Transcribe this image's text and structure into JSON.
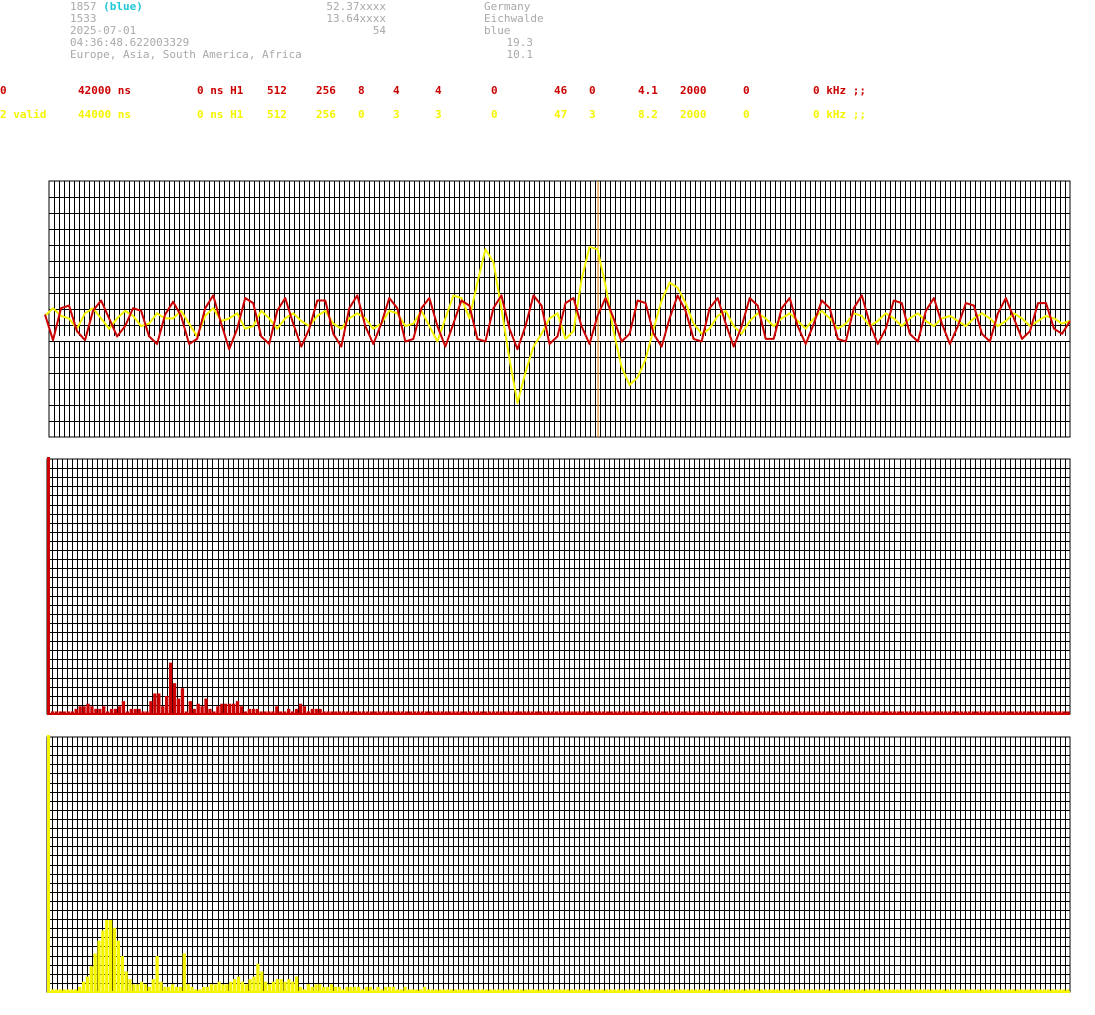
{
  "station": {
    "id": "1857",
    "id_tag": "(blue)",
    "number": "1533",
    "date": "2025-07-01",
    "time": "04:36:48.622003329",
    "regions": "Europe, Asia, South America, Africa",
    "lat": "52.37xxxx",
    "lon": "13.64xxxx",
    "alt": "54",
    "country": "Germany",
    "city": "Eichwalde",
    "color_name": "blue",
    "value1": "19.3",
    "value2": "10.1"
  },
  "channels": [
    {
      "c0": "0",
      "c1": "42000 ns",
      "c2": "0 ns H1",
      "c3": "512",
      "c4": "256",
      "c5": "8",
      "c6": "4",
      "c7": "4",
      "c8": "0",
      "c9": "46",
      "c10": "0",
      "c11": "4.1",
      "c12": "2000",
      "c13": "0",
      "c14": "0 kHz ;;",
      "color": "#cc0000"
    },
    {
      "c0": "2 valid",
      "c1": "44000 ns",
      "c2": "0 ns H1",
      "c3": "512",
      "c4": "256",
      "c5": "0",
      "c6": "3",
      "c7": "3",
      "c8": "0",
      "c9": "47",
      "c10": "3",
      "c11": "8.2",
      "c12": "2000",
      "c13": "0",
      "c14": "0 kHz ;;",
      "color": "#f5f500"
    }
  ],
  "colors": {
    "red": "#cc0000",
    "yellow": "#f5f500",
    "cursor": "#e08000",
    "grid": "#000000"
  },
  "chart_data": [
    {
      "type": "line",
      "title": "",
      "x": [
        0,
        1,
        2,
        3,
        4,
        5,
        6,
        7,
        8,
        9,
        10,
        11,
        12,
        13,
        14,
        15,
        16,
        17,
        18,
        19,
        20,
        21,
        22,
        23,
        24,
        25,
        26,
        27,
        28,
        29,
        30,
        31,
        32,
        33,
        34,
        35,
        36,
        37,
        38,
        39,
        40,
        41,
        42,
        43,
        44,
        45,
        46,
        47,
        48,
        49,
        50,
        51,
        52,
        53,
        54,
        55,
        56,
        57,
        58,
        59,
        60,
        61,
        62,
        63,
        64,
        65,
        66,
        67,
        68,
        69,
        70,
        71,
        72,
        73,
        74,
        75,
        76,
        77,
        78,
        79,
        80,
        81,
        82,
        83,
        84,
        85,
        86,
        87,
        88,
        89,
        90,
        91,
        92,
        93,
        94,
        95,
        96,
        97,
        98,
        99,
        100,
        101,
        102,
        103,
        104,
        105,
        106,
        107,
        108,
        109,
        110,
        111,
        112,
        113,
        114,
        115,
        116,
        117,
        118,
        119,
        120,
        121,
        122,
        123,
        124,
        125,
        126,
        127,
        128
      ],
      "ylim": [
        -1,
        1
      ],
      "grid": true,
      "cursor_x": 69,
      "series": [
        {
          "color": "#cc0000",
          "values": [
            0.05,
            -0.15,
            0.1,
            0.12,
            -0.08,
            -0.15,
            0.08,
            0.16,
            0.02,
            -0.12,
            -0.04,
            0.1,
            0.08,
            -0.12,
            -0.18,
            0.05,
            0.15,
            0.04,
            -0.18,
            -0.14,
            0.1,
            0.2,
            -0.02,
            -0.22,
            -0.06,
            0.18,
            0.14,
            -0.12,
            -0.18,
            0.08,
            0.18,
            -0.02,
            -0.2,
            -0.06,
            0.16,
            0.16,
            -0.1,
            -0.2,
            0.1,
            0.2,
            -0.04,
            -0.18,
            -0.02,
            0.18,
            0.1,
            -0.16,
            -0.14,
            0.1,
            0.18,
            -0.04,
            -0.2,
            -0.02,
            0.16,
            0.12,
            -0.14,
            -0.16,
            0.1,
            0.2,
            -0.06,
            -0.22,
            -0.04,
            0.2,
            0.12,
            -0.18,
            -0.12,
            0.14,
            0.18,
            -0.04,
            -0.18,
            0.04,
            0.18,
            0.02,
            -0.16,
            -0.1,
            0.16,
            0.14,
            -0.1,
            -0.2,
            0.02,
            0.2,
            0.08,
            -0.14,
            -0.16,
            0.1,
            0.18,
            -0.02,
            -0.2,
            -0.04,
            0.18,
            0.12,
            -0.14,
            -0.14,
            0.1,
            0.18,
            -0.04,
            -0.18,
            -0.02,
            0.16,
            0.1,
            -0.14,
            -0.16,
            0.1,
            0.2,
            -0.02,
            -0.18,
            -0.06,
            0.16,
            0.14,
            -0.1,
            -0.16,
            0.08,
            0.18,
            -0.02,
            -0.18,
            -0.04,
            0.14,
            0.12,
            -0.1,
            -0.16,
            0.06,
            0.18,
            0.02,
            -0.14,
            -0.08,
            0.14,
            0.14,
            -0.06,
            -0.1,
            0.0
          ]
        },
        {
          "color": "#f5f500",
          "values": [
            0.04,
            0.1,
            0.04,
            0.02,
            -0.06,
            0.06,
            0.1,
            0.02,
            -0.06,
            0.02,
            0.08,
            0.04,
            -0.04,
            -0.02,
            0.06,
            0.02,
            0.02,
            0.08,
            -0.02,
            -0.12,
            0.04,
            0.1,
            0.0,
            0.02,
            0.06,
            -0.06,
            -0.04,
            0.08,
            0.02,
            -0.06,
            0.02,
            0.06,
            0.0,
            -0.04,
            0.04,
            0.08,
            -0.02,
            -0.06,
            0.02,
            0.06,
            0.02,
            -0.06,
            -0.02,
            0.08,
            0.06,
            -0.04,
            -0.02,
            0.08,
            -0.04,
            -0.16,
            0.02,
            0.2,
            0.18,
            0.02,
            0.3,
            0.56,
            0.46,
            0.1,
            -0.3,
            -0.64,
            -0.4,
            -0.2,
            -0.1,
            0.02,
            0.06,
            -0.14,
            -0.08,
            0.32,
            0.58,
            0.56,
            0.28,
            -0.08,
            -0.36,
            -0.5,
            -0.44,
            -0.3,
            -0.06,
            0.16,
            0.3,
            0.26,
            0.14,
            -0.02,
            -0.1,
            -0.06,
            0.04,
            0.08,
            -0.04,
            -0.1,
            0.0,
            0.06,
            0.02,
            -0.04,
            0.02,
            0.06,
            0.0,
            -0.06,
            0.02,
            0.08,
            0.02,
            -0.06,
            -0.02,
            0.06,
            0.04,
            -0.04,
            0.0,
            0.06,
            0.02,
            -0.04,
            0.02,
            0.06,
            0.0,
            -0.04,
            0.02,
            0.04,
            0.0,
            -0.04,
            0.02,
            0.06,
            0.02,
            -0.04,
            0.0,
            0.06,
            0.02,
            -0.04,
            0.0,
            0.04,
            0.02,
            -0.02,
            0.0
          ]
        }
      ]
    },
    {
      "type": "bar",
      "title": "",
      "color": "#cc0000",
      "ylim": [
        0,
        100
      ],
      "grid": true,
      "values": [
        100,
        1,
        1,
        1,
        1,
        1,
        1,
        2,
        3,
        3,
        4,
        3,
        2,
        2,
        3,
        1,
        2,
        2,
        3,
        5,
        1,
        2,
        2,
        2,
        1,
        1,
        5,
        8,
        8,
        3,
        7,
        20,
        12,
        6,
        10,
        1,
        5,
        2,
        4,
        3,
        6,
        2,
        1,
        3,
        4,
        4,
        4,
        4,
        5,
        3,
        1,
        2,
        2,
        2,
        1,
        1,
        1,
        1,
        3,
        1,
        1,
        2,
        1,
        2,
        4,
        3,
        1,
        2,
        2,
        2,
        1,
        1,
        1,
        1,
        1,
        1,
        1,
        1,
        1,
        1,
        1,
        1,
        1,
        1,
        1,
        1,
        1,
        1,
        1,
        1,
        1,
        1,
        1,
        1,
        1,
        1,
        1,
        1,
        1,
        1,
        1,
        1,
        1,
        1,
        1,
        1,
        1,
        1,
        1,
        1,
        1,
        1,
        1,
        1,
        1,
        1,
        1,
        1,
        1,
        1,
        1,
        1,
        1,
        1,
        1,
        1,
        1,
        1,
        1,
        1,
        1,
        1,
        1,
        1,
        1,
        1,
        1,
        1,
        1,
        1,
        1,
        1,
        1,
        1,
        1,
        1,
        1,
        1,
        1,
        1,
        1,
        1,
        1,
        1,
        1,
        1,
        1,
        1,
        1,
        1,
        1,
        1,
        1,
        1,
        1,
        1,
        1,
        1,
        1,
        1,
        1,
        1,
        1,
        1,
        1,
        1,
        1,
        1,
        1,
        1,
        1,
        1,
        1,
        1,
        1,
        1,
        1,
        1,
        1,
        1,
        1,
        1,
        1,
        1,
        1,
        1,
        1,
        1,
        1,
        1,
        1,
        1,
        1,
        1,
        1,
        1,
        1,
        1,
        1,
        1,
        1,
        1,
        1,
        1,
        1,
        1,
        1,
        1,
        1,
        1,
        1,
        1,
        1,
        1,
        1,
        1,
        1,
        1,
        1,
        1,
        1,
        1,
        1,
        1,
        1,
        1,
        1,
        1,
        1,
        1,
        1,
        1,
        1,
        1,
        1,
        1,
        1,
        1,
        1,
        1,
        1,
        1,
        1,
        1,
        1,
        1,
        1,
        1,
        1,
        1
      ]
    },
    {
      "type": "bar",
      "title": "",
      "color": "#f5f500",
      "ylim": [
        0,
        100
      ],
      "grid": true,
      "values": [
        100,
        1,
        1,
        1,
        1,
        1,
        1,
        1,
        2,
        4,
        6,
        10,
        15,
        20,
        24,
        28,
        28,
        25,
        20,
        14,
        8,
        5,
        3,
        3,
        4,
        3,
        2,
        5,
        14,
        4,
        2,
        2,
        3,
        2,
        2,
        15,
        3,
        2,
        1,
        1,
        2,
        2,
        3,
        3,
        4,
        3,
        3,
        4,
        5,
        6,
        4,
        3,
        5,
        6,
        11,
        8,
        4,
        3,
        4,
        5,
        5,
        4,
        5,
        4,
        6,
        2,
        1,
        3,
        2,
        3,
        3,
        2,
        2,
        3,
        2,
        2,
        1,
        2,
        2,
        2,
        2,
        1,
        2,
        2,
        1,
        2,
        1,
        2,
        2,
        2,
        1,
        1,
        2,
        1,
        1,
        1,
        1,
        2,
        1,
        1,
        1,
        1,
        1,
        1,
        1,
        1,
        1,
        1,
        1,
        1,
        1,
        1,
        1,
        1,
        1,
        1,
        1,
        1,
        1,
        1,
        1,
        1,
        1,
        1,
        1,
        1,
        1,
        1,
        1,
        1,
        1,
        1,
        1,
        1,
        1,
        1,
        1,
        1,
        1,
        1,
        1,
        1,
        1,
        1,
        1,
        1,
        1,
        1,
        1,
        1,
        1,
        1,
        1,
        1,
        1,
        1,
        1,
        1,
        1,
        1,
        1,
        1,
        1,
        1,
        1,
        1,
        1,
        1,
        1,
        1,
        1,
        1,
        1,
        1,
        1,
        1,
        1,
        1,
        1,
        1,
        1,
        1,
        1,
        1,
        1,
        1,
        1,
        1,
        1,
        1,
        1,
        1,
        1,
        1,
        1,
        1,
        1,
        1,
        1,
        1,
        1,
        1,
        1,
        1,
        1,
        1,
        1,
        1,
        1,
        1,
        1,
        1,
        1,
        1,
        1,
        1,
        1,
        1,
        1,
        1,
        1,
        1,
        1,
        1,
        1,
        1,
        1,
        1,
        1,
        1,
        1,
        1,
        1,
        1,
        1,
        1,
        1,
        1,
        1,
        1,
        1,
        1,
        1,
        1,
        1,
        1,
        1,
        1,
        1,
        1,
        1,
        1,
        1,
        1,
        1,
        1,
        1,
        1,
        1,
        1,
        1,
        1,
        1,
        1
      ]
    }
  ]
}
